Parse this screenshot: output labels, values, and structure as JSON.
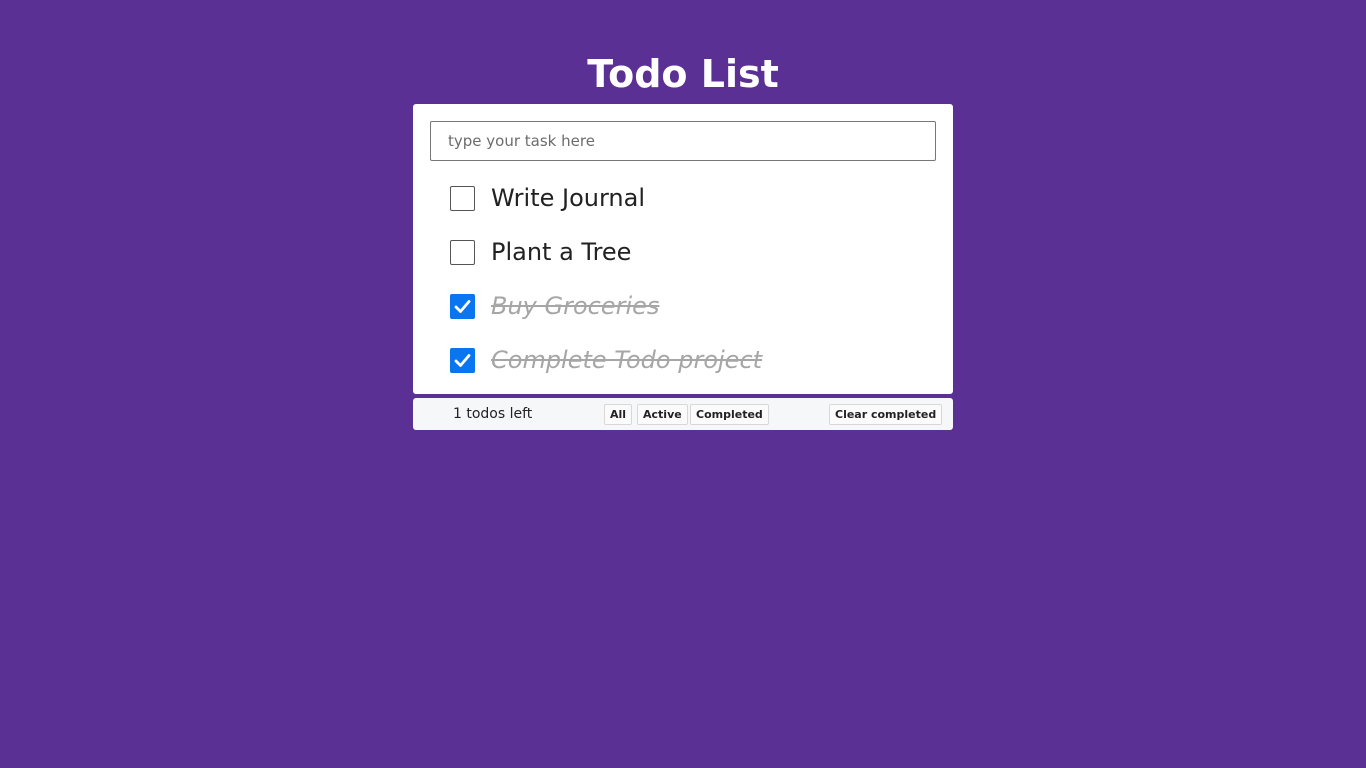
{
  "app": {
    "title": "Todo List"
  },
  "input": {
    "placeholder": "type your task here",
    "value": ""
  },
  "todos": [
    {
      "text": "Write Journal",
      "completed": false
    },
    {
      "text": "Plant a Tree",
      "completed": false
    },
    {
      "text": "Buy Groceries",
      "completed": true
    },
    {
      "text": "Complete Todo project",
      "completed": true
    }
  ],
  "footer": {
    "count_text": "1 todos left",
    "filters": {
      "all": "All",
      "active": "Active",
      "completed": "Completed"
    },
    "clear_completed": "Clear completed"
  },
  "colors": {
    "background": "#5a3095",
    "checkbox_checked": "#0a75f0",
    "completed_text": "#a6a6a6"
  },
  "icons": {
    "check": "checkmark-icon"
  }
}
